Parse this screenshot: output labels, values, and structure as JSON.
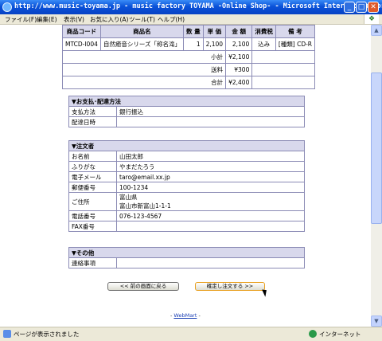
{
  "window": {
    "title": "http://www.music-toyama.jp - music factory TOYAMA -Online Shop- - Microsoft Internet Explorer",
    "min": "_",
    "max": "□",
    "close": "✕"
  },
  "menu": [
    "ファイル(F)",
    "編集(E)",
    "表示(V)",
    "お気に入り(A)",
    "ツール(T)",
    "ヘルプ(H)"
  ],
  "order": {
    "headers": [
      "商品コード",
      "商品名",
      "数 量",
      "単 価",
      "金 額",
      "消費税",
      "備 考"
    ],
    "row": {
      "code": "MTCD-I004",
      "name": "自然癒音シリーズ「称名滝」",
      "qty": "1",
      "price": "2,100",
      "amount": "2,100",
      "tax": "込み",
      "note": "[種類] CD-R"
    },
    "subtotal": {
      "label": "小計",
      "value": "¥2,100"
    },
    "shipping": {
      "label": "送料",
      "value": "¥300"
    },
    "total": {
      "label": "合計",
      "value": "¥2,400"
    }
  },
  "payment": {
    "header": "▼お支払･配達方法",
    "method_label": "支払方法",
    "method_value": "銀行振込",
    "date_label": "配達日時",
    "date_value": ""
  },
  "customer": {
    "header": "▼注文者",
    "name_label": "お名前",
    "name_value": "山田太郎",
    "kana_label": "ふりがな",
    "kana_value": "やまだたろう",
    "email_label": "電子メール",
    "email_value": "taro@email.xx.jp",
    "zip_label": "郵便番号",
    "zip_value": "100-1234",
    "address_label": "ご住所",
    "address_line1": "富山県",
    "address_line2": "富山市新富山1-1-1",
    "phone_label": "電話番号",
    "phone_value": "076-123-4567",
    "fax_label": "FAX番号",
    "fax_value": ""
  },
  "other": {
    "header": "▼その他",
    "contact_label": "連絡事項",
    "contact_value": ""
  },
  "buttons": {
    "back": "<< 前の画面に戻る",
    "confirm": "確定し注文する >>"
  },
  "footer": {
    "prefix": "- ",
    "link": "WebMart",
    "suffix": " -"
  },
  "status": {
    "text": "ページが表示されました",
    "zone": "インターネット"
  }
}
